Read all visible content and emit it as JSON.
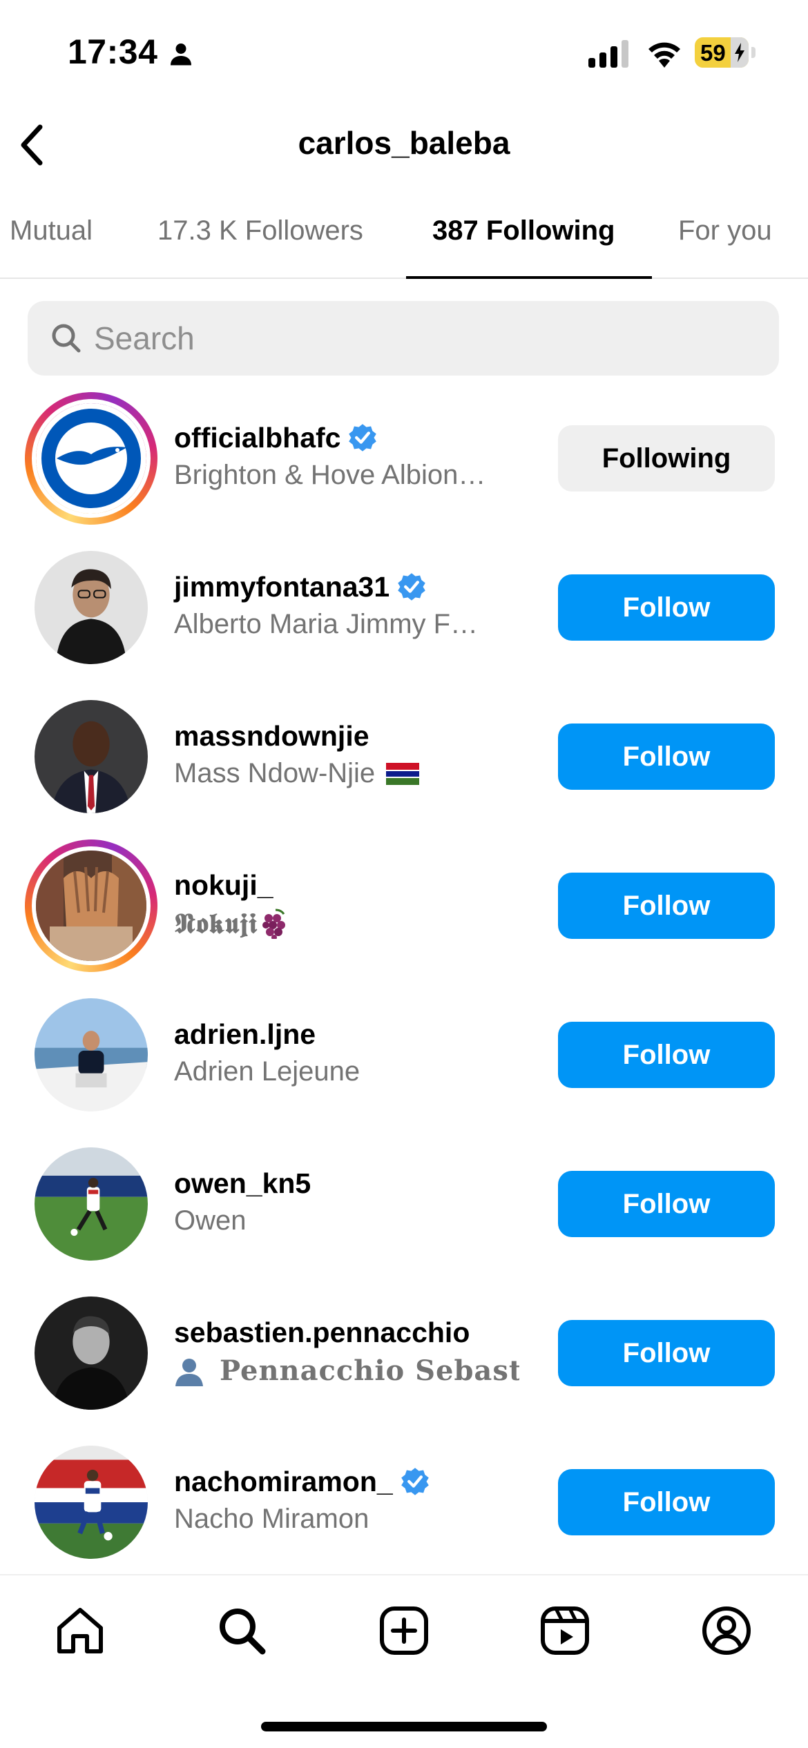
{
  "status_bar": {
    "time": "17:34",
    "battery": "59"
  },
  "header": {
    "title": "carlos_baleba"
  },
  "tabs": [
    {
      "label": "Mutual"
    },
    {
      "label": "17.3 K Followers"
    },
    {
      "label": "387 Following"
    },
    {
      "label": "For you"
    }
  ],
  "search": {
    "placeholder": "Search",
    "value": ""
  },
  "accounts": [
    {
      "username": "officialbhafc",
      "name": "Brighton & Hove Albion…",
      "verified": true,
      "button": "Following"
    },
    {
      "username": "jimmyfontana31",
      "name": "Alberto Maria Jimmy F…",
      "verified": true,
      "button": "Follow"
    },
    {
      "username": "massndownjie",
      "name": "Mass Ndow-Njie",
      "verified": false,
      "button": "Follow"
    },
    {
      "username": "nokuji_",
      "name": "𝕹𝖔𝖐𝖚𝖏𝖎",
      "verified": false,
      "button": "Follow"
    },
    {
      "username": "adrien.ljne",
      "name": "Adrien Lejeune",
      "verified": false,
      "button": "Follow"
    },
    {
      "username": "owen_kn5",
      "name": "Owen",
      "verified": false,
      "button": "Follow"
    },
    {
      "username": "sebastien.pennacchio",
      "name": "Pennacchio Sebasti…",
      "verified": false,
      "button": "Follow"
    },
    {
      "username": "nachomiramon_",
      "name": "Nacho Miramon",
      "verified": true,
      "button": "Follow"
    }
  ],
  "colors": {
    "follow_blue": "#0095f6",
    "verified_blue": "#3897f0",
    "secondary_text": "#737373"
  },
  "bottom_nav": [
    "home-icon",
    "search-icon",
    "create-icon",
    "reels-icon",
    "profile-icon"
  ]
}
